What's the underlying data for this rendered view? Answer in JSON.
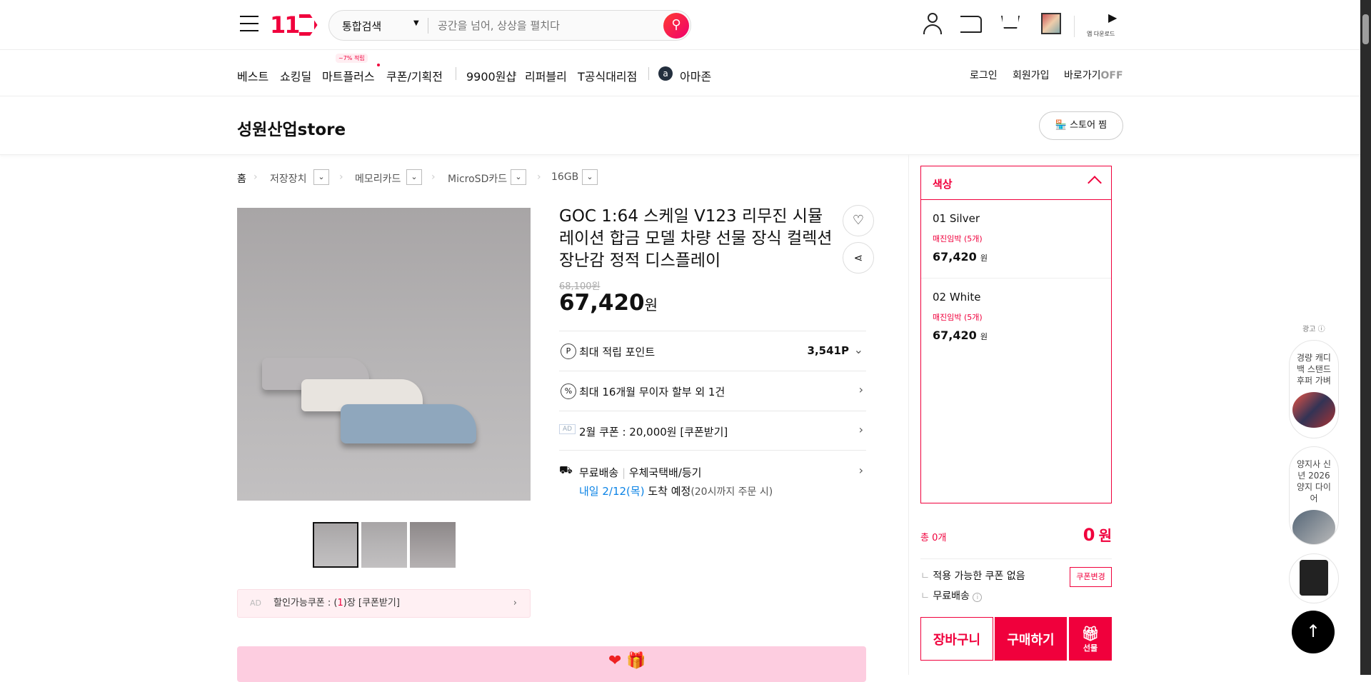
{
  "header": {
    "logo": "11번가",
    "search_scope": "통합검색",
    "search_placeholder": "공간을 넘어, 상상을 펼치다",
    "app_download": "앱 다운로드"
  },
  "nav": {
    "items": [
      "베스트",
      "쇼킹딜",
      "마트플러스",
      "쿠폰/기획전",
      "9900원샵",
      "리퍼블리",
      "T공식대리점",
      "아마존"
    ],
    "badge": "~7% 적립",
    "login": "로그인",
    "signup": "회원가입",
    "shortcut": "바로가기",
    "shortcut_state": "OFF"
  },
  "store": {
    "name": "성원산업store",
    "follow": "스토어 찜"
  },
  "breadcrumb": [
    "홈",
    "저장장치",
    "메모리카드",
    "MicroSD카드",
    "16GB"
  ],
  "product": {
    "title": "GOC 1:64 스케일 V123 리무진 시뮬레이션 합금 모델 차량 선물 장식 컬렉션 장난감 정적 디스플레이",
    "original_price": "68,100원",
    "price": "67,420",
    "won": "원",
    "points_label": "최대 적립 포인트",
    "points_value": "3,541P",
    "installment": "최대 16개월 무이자 할부 외 1건",
    "ad_tag": "AD",
    "coupon": "2월 쿠폰 : 20,000원 [쿠폰받기]",
    "shipping": "무료배송",
    "shipping_method": "우체국택배/등기",
    "arrival_date": "내일 2/12(목)",
    "arrival_text": "도착 예정",
    "arrival_note": "(20시까지 주문 시)"
  },
  "coupon_bar": {
    "tag": "AD",
    "prefix": "할인가능쿠폰 : (",
    "count": "1",
    "suffix": ")장 [쿠폰받기]"
  },
  "options": {
    "title": "색상",
    "items": [
      {
        "name": "01 Silver",
        "stock": "매진임박 (5개)",
        "price": "67,420",
        "won": "원"
      },
      {
        "name": "02 White",
        "stock": "매진임박 (5개)",
        "price": "67,420",
        "won": "원"
      }
    ]
  },
  "summary": {
    "total_count": "총 0개",
    "total_price": "0",
    "won": "원",
    "coupon_none": "적용 가능한 쿠폰 없음",
    "coupon_change": "쿠폰변경",
    "free_shipping": "무료배송"
  },
  "actions": {
    "cart": "장바구니",
    "buy": "구매하기",
    "gift": "선물"
  },
  "side_ads": {
    "label": "광고",
    "items": [
      "경량 캐디백 스탠드 후퍼 가벼",
      "양지사 신년 2026 양지 다이어"
    ]
  },
  "colors": {
    "brand": "#f0003c",
    "link": "#0b83e6"
  }
}
